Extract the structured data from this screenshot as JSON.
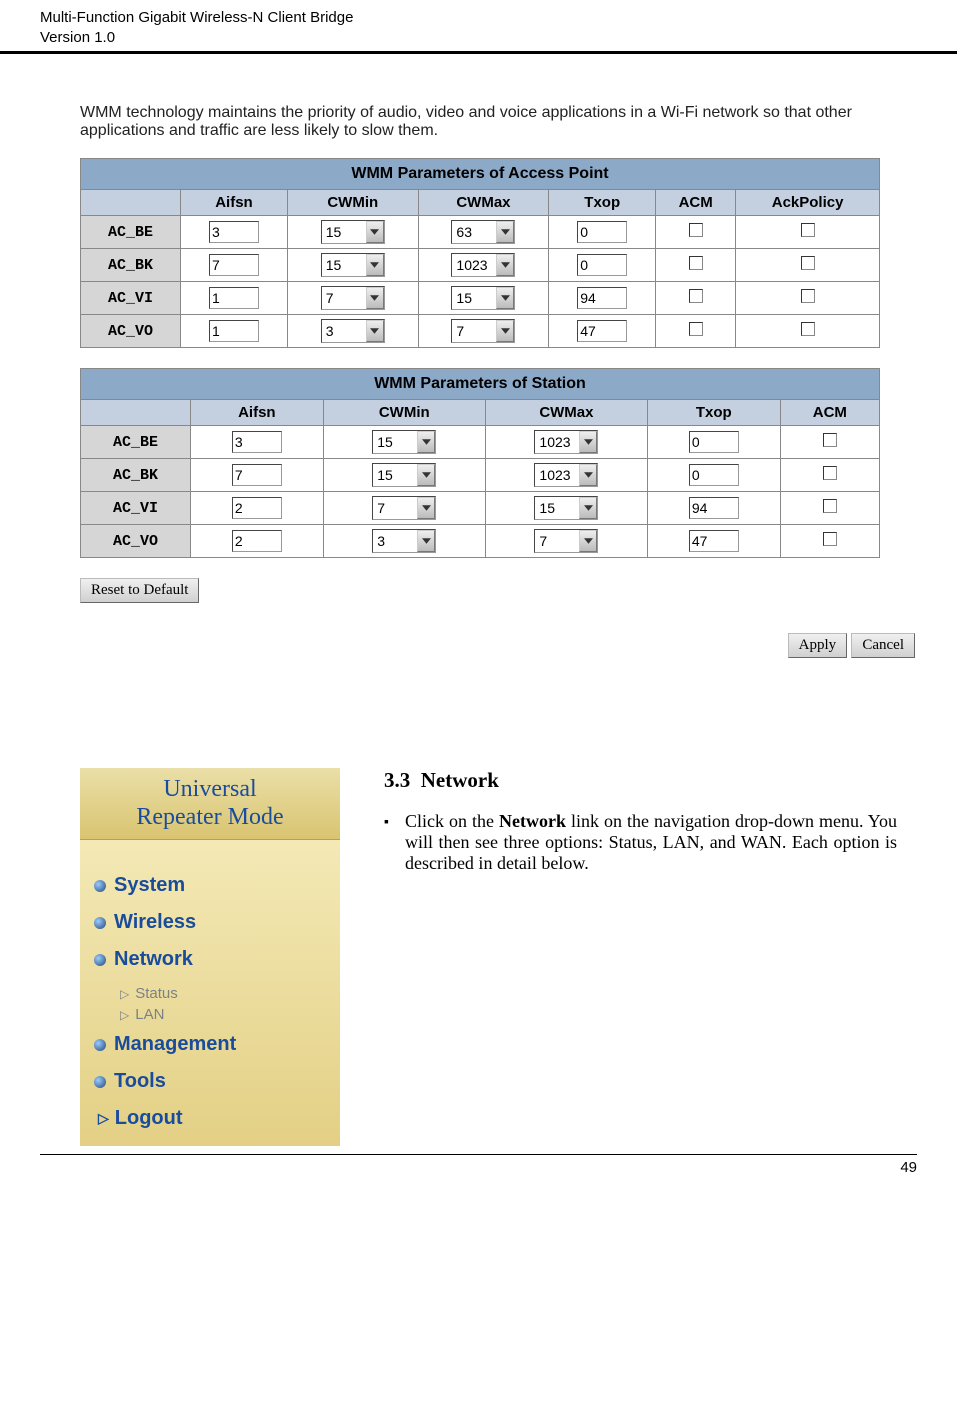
{
  "header": {
    "line1": "Multi-Function Gigabit Wireless-N Client Bridge",
    "line2": "Version 1.0"
  },
  "intro": "WMM technology maintains the priority of audio, video and voice applications in a Wi-Fi network so that other applications and traffic are less likely to slow them.",
  "table1": {
    "title": "WMM Parameters of Access Point",
    "cols": [
      "Aifsn",
      "CWMin",
      "CWMax",
      "Txop",
      "ACM",
      "AckPolicy"
    ],
    "rows": [
      {
        "name": "AC_BE",
        "aifsn": "3",
        "cwmin": "15",
        "cwmax": "63",
        "txop": "0"
      },
      {
        "name": "AC_BK",
        "aifsn": "7",
        "cwmin": "15",
        "cwmax": "1023",
        "txop": "0"
      },
      {
        "name": "AC_VI",
        "aifsn": "1",
        "cwmin": "7",
        "cwmax": "15",
        "txop": "94"
      },
      {
        "name": "AC_VO",
        "aifsn": "1",
        "cwmin": "3",
        "cwmax": "7",
        "txop": "47"
      }
    ]
  },
  "table2": {
    "title": "WMM Parameters of Station",
    "cols": [
      "Aifsn",
      "CWMin",
      "CWMax",
      "Txop",
      "ACM"
    ],
    "rows": [
      {
        "name": "AC_BE",
        "aifsn": "3",
        "cwmin": "15",
        "cwmax": "1023",
        "txop": "0"
      },
      {
        "name": "AC_BK",
        "aifsn": "7",
        "cwmin": "15",
        "cwmax": "1023",
        "txop": "0"
      },
      {
        "name": "AC_VI",
        "aifsn": "2",
        "cwmin": "7",
        "cwmax": "15",
        "txop": "94"
      },
      {
        "name": "AC_VO",
        "aifsn": "2",
        "cwmin": "3",
        "cwmax": "7",
        "txop": "47"
      }
    ]
  },
  "buttons": {
    "reset": "Reset to Default",
    "apply": "Apply",
    "cancel": "Cancel"
  },
  "nav": {
    "title1": "Universal",
    "title2": "Repeater Mode",
    "items": [
      "System",
      "Wireless",
      "Network"
    ],
    "subs": [
      "Status",
      "LAN"
    ],
    "items2": [
      "Management",
      "Tools"
    ],
    "logout": "Logout"
  },
  "section": {
    "num": "3.3",
    "title": "Network",
    "text_pre": "Click on the ",
    "text_bold": "Network",
    "text_post": " link on the navigation drop-down menu. You will then see three options: Status, LAN, and WAN. Each option is described in detail below."
  },
  "page_number": "49"
}
